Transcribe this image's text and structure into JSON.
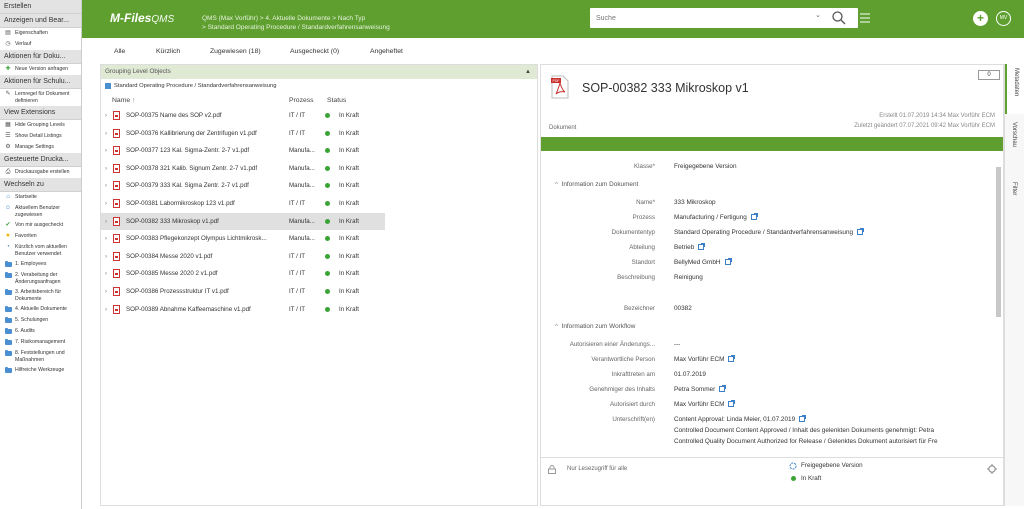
{
  "app": {
    "logo": "M-Files",
    "logo_sub": "QMS"
  },
  "breadcrumb": {
    "line1": "QMS (Max Vorführ) > 4. Aktuelle Dokumente > Nach Typ",
    "line2": "> Standard Operating Procedure / Standardverfahrensanweisung"
  },
  "search": {
    "placeholder": "Suche"
  },
  "avatar": "MV",
  "left_panel": [
    {
      "type": "head",
      "label": "Erstellen"
    },
    {
      "type": "head",
      "label": "Anzeigen und Bear..."
    },
    {
      "type": "item",
      "icon": "properties-icon",
      "label": "Eigenschaften"
    },
    {
      "type": "item",
      "icon": "history-icon",
      "label": "Verlauf"
    },
    {
      "type": "head",
      "label": "Aktionen für Doku..."
    },
    {
      "type": "item",
      "icon": "new-version-icon",
      "label": "Neue Version anfragen"
    },
    {
      "type": "head",
      "label": "Aktionen für Schulu..."
    },
    {
      "type": "item",
      "icon": "learning-rule-icon",
      "label": "Lernregel für Dokument definieren"
    },
    {
      "type": "head",
      "label": "View Extensions"
    },
    {
      "type": "item",
      "icon": "grouping-icon",
      "label": "Hide Grouping Levels"
    },
    {
      "type": "item",
      "icon": "listing-icon",
      "label": "Show Detail Listings"
    },
    {
      "type": "item",
      "icon": "settings-icon",
      "label": "Manage Settings"
    },
    {
      "type": "head",
      "label": "Gesteuerte Drucka..."
    },
    {
      "type": "item",
      "icon": "print-icon",
      "label": "Druckausgabe erstellen"
    },
    {
      "type": "head",
      "label": "Wechseln zu"
    },
    {
      "type": "item",
      "icon": "home-icon",
      "label": "Startseite"
    },
    {
      "type": "item",
      "icon": "assigned-icon",
      "label": "Aktuellem Benutzer zugewiesen"
    },
    {
      "type": "item",
      "icon": "checkout-icon",
      "label": "Von mir ausgecheckt"
    },
    {
      "type": "item",
      "icon": "star-icon",
      "label": "Favoriten"
    },
    {
      "type": "item",
      "icon": "recent-icon",
      "label": "Kürzlich vom aktuellen Benutzer verwendet"
    },
    {
      "type": "item",
      "icon": "folder-icon",
      "label": "1. Employees"
    },
    {
      "type": "item",
      "icon": "folder-icon",
      "label": "2. Verabeitung der Änderungsanfragen"
    },
    {
      "type": "item",
      "icon": "folder-icon",
      "label": "3. Arbeitsbereich für Dokumente"
    },
    {
      "type": "item",
      "icon": "folder-icon",
      "label": "4. Aktuelle Dokumente"
    },
    {
      "type": "item",
      "icon": "folder-icon",
      "label": "5. Schulungen"
    },
    {
      "type": "item",
      "icon": "folder-icon",
      "label": "6. Audits"
    },
    {
      "type": "item",
      "icon": "folder-icon",
      "label": "7. Risikomanagement"
    },
    {
      "type": "item",
      "icon": "folder-icon",
      "label": "8. Feststellungen und Maßnahmen"
    },
    {
      "type": "item",
      "icon": "folder-icon",
      "label": "Hilfreiche Werkzeuge"
    }
  ],
  "tabs": [
    "Alle",
    "Kürzlich",
    "Zugewiesen (18)",
    "Ausgecheckt (0)",
    "Angeheftet"
  ],
  "list": {
    "group_header": "Grouping Level Objects",
    "group_sub": "Standard Operating Procedure / Standardverfahrensanweisung",
    "columns": {
      "name": "Name",
      "sort": "↑",
      "process": "Prozess",
      "status": "Status"
    },
    "rows": [
      {
        "name": "SOP-00375 Name des SOP v2.pdf",
        "process": "IT / IT",
        "status": "In Kraft"
      },
      {
        "name": "SOP-00376 Kallibrierung der Zentrifugen v1.pdf",
        "process": "IT / IT",
        "status": "In Kraft"
      },
      {
        "name": "SOP-00377 123 Kal. Sigma-Zentr. 2-7 v1.pdf",
        "process": "Manufa...",
        "status": "In Kraft"
      },
      {
        "name": "SOP-00378 321 Kalib. Signum Zentr. 2-7 v1.pdf",
        "process": "Manufa...",
        "status": "In Kraft"
      },
      {
        "name": "SOP-00379 333 Kal. Sigma Zentr. 2-7 v1.pdf",
        "process": "Manufa...",
        "status": "In Kraft"
      },
      {
        "name": "SOP-00381 Labormikroskop 123 v1.pdf",
        "process": "IT / IT",
        "status": "In Kraft"
      },
      {
        "name": "SOP-00382 333 Mikroskop v1.pdf",
        "process": "Manufa...",
        "status": "In Kraft"
      },
      {
        "name": "SOP-00383 Pflegekonzept Olympus Lichtmikrosk...",
        "process": "Manufa...",
        "status": "In Kraft"
      },
      {
        "name": "SOP-00384 Messe 2020 v1.pdf",
        "process": "IT / IT",
        "status": "In Kraft"
      },
      {
        "name": "SOP-00385 Messe 2020 2 v1.pdf",
        "process": "IT / IT",
        "status": "In Kraft"
      },
      {
        "name": "SOP-00386 Prozessstruktur IT v1.pdf",
        "process": "IT / IT",
        "status": "In Kraft"
      },
      {
        "name": "SOP-00389 Abnahme Kaffeemaschine v1.pdf",
        "process": "IT / IT",
        "status": "In Kraft"
      }
    ],
    "selected_index": 6
  },
  "detail": {
    "title": "SOP-00382 333 Mikroskop v1",
    "count": "0",
    "created": "Erstellt 01.07.2019 14:34 Max Vorführ ECM",
    "modified": "Zuletzt geändert 07.07.2021 09:42 Max Vorführ ECM",
    "type": "Dokument",
    "fields": {
      "klasse_l": "Klasse*",
      "klasse_v": "Freigegebene Version",
      "sec1": "Information zum Dokument",
      "name_l": "Name*",
      "name_v": "333 Mikroskop",
      "prozess_l": "Prozess",
      "prozess_v": "Manufacturing / Fertigung",
      "doktyp_l": "Dokumententyp",
      "doktyp_v": "Standard Operating Procedure / Standardverfahrensanweisung",
      "abt_l": "Abteilung",
      "abt_v": "Betrieb",
      "stand_l": "Standort",
      "stand_v": "BellyMed GmbH",
      "beschr_l": "Beschreibung",
      "beschr_v": "Reinigung",
      "bez_l": "Bezeichner",
      "bez_v": "00382",
      "sec2": "Information zum Workflow",
      "auto_l": "Autorisieren einer Änderungs...",
      "auto_v": "---",
      "verant_l": "Verantwortliche Person",
      "verant_v": "Max Vorführ ECM",
      "inkr_l": "Inkrafttreten am",
      "inkr_v": "01.07.2019",
      "gen_l": "Genehmiger des Inhalts",
      "gen_v": "Petra Sommer",
      "autd_l": "Autorisiert durch",
      "autd_v": "Max Vorführ ECM",
      "unt_l": "Unterschrift(en)",
      "unt_v1": "Content Approval: Linda Meier, 01.07.2019",
      "unt_v2": "Controlled Document Content Approved / Inhalt des gelenkten Dokuments genehmigt: Petra",
      "unt_v3": "Controlled Quality Document Authorized for Release / Gelenktes Dokument autorisiert für Fre"
    },
    "footer": {
      "readonly": "Nur Lesezugriff für alle",
      "workflow": "Freigegebene Version",
      "state": "In Kraft"
    }
  },
  "right_tabs": [
    "Metadaten",
    "Vorschau",
    "Filter"
  ]
}
